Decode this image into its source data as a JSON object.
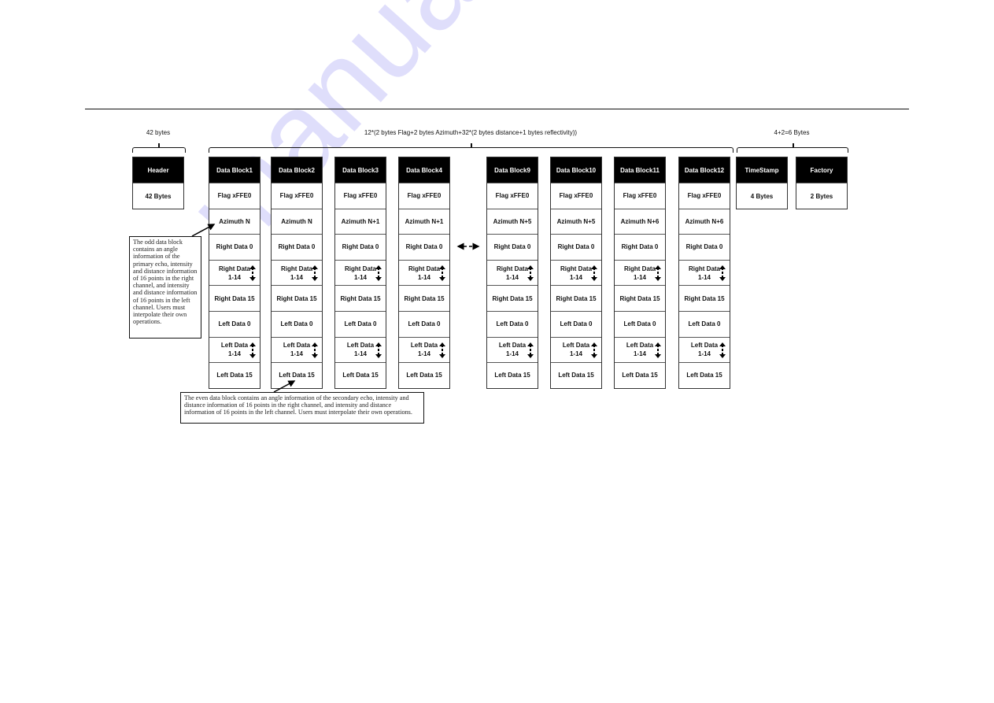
{
  "watermark": "manualshive.com",
  "top_labels": {
    "header_bytes": "42 bytes",
    "data_formula": "12*(2 bytes Flag+2 bytes Azimuth+32*(2 bytes  distance+1 bytes reflectivity))",
    "tail_bytes": "4+2=6 Bytes"
  },
  "header_block": {
    "title": "Header",
    "value": "42 Bytes"
  },
  "tail_blocks": [
    {
      "title": "TimeStamp",
      "value": "4 Bytes"
    },
    {
      "title": "Factory",
      "value": "2 Bytes"
    }
  ],
  "data_blocks": [
    {
      "title": "Data  Block1",
      "flag": "Flag xFFE0",
      "azimuth": "Azimuth N"
    },
    {
      "title": "Data  Block2",
      "flag": "Flag xFFE0",
      "azimuth": "Azimuth N"
    },
    {
      "title": "Data  Block3",
      "flag": "Flag xFFE0",
      "azimuth": "Azimuth N+1"
    },
    {
      "title": "Data  Block4",
      "flag": "Flag xFFE0",
      "azimuth": "Azimuth N+1"
    },
    {
      "title": "Data  Block9",
      "flag": "Flag xFFE0",
      "azimuth": "Azimuth N+5"
    },
    {
      "title": "Data  Block10",
      "flag": "Flag xFFE0",
      "azimuth": "Azimuth N+5"
    },
    {
      "title": "Data  Block11",
      "flag": "Flag xFFE0",
      "azimuth": "Azimuth N+6"
    },
    {
      "title": "Data  Block12",
      "flag": "Flag xFFE0",
      "azimuth": "Azimuth N+6"
    }
  ],
  "rows": {
    "right0": "Right Data   0",
    "right_mid_1": "Right Data",
    "right_mid_2": "1-14",
    "right15": "Right Data  15",
    "left0": "Left Data  0",
    "left_mid_1": "Left Data",
    "left_mid_2": "1-14",
    "left15": "Left Data  15"
  },
  "notes": {
    "odd": "The odd data block contains an angle information of the primary echo, intensity and distance information of 16 points in the right channel, and intensity and distance information of 16 points in the left channel. Users must interpolate their own operations.",
    "even": "The even data block contains an angle information of the secondary echo, intensity and distance information of 16 points in the right channel, and intensity and distance information of 16 points in the left channel. Users must interpolate their own operations."
  }
}
